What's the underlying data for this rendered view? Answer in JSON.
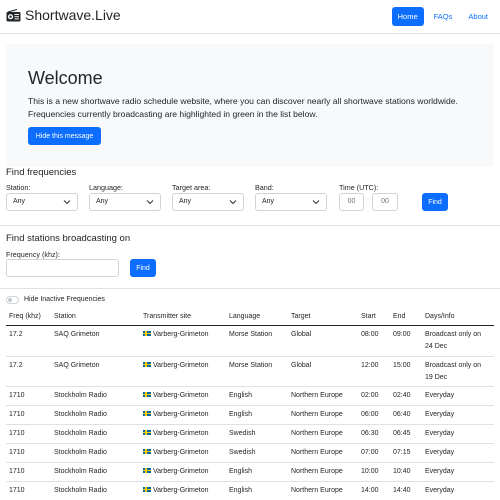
{
  "nav": {
    "brand": "Shortwave.Live",
    "links": [
      {
        "label": "Home",
        "active": true
      },
      {
        "label": "FAQs",
        "active": false
      },
      {
        "label": "About",
        "active": false
      }
    ]
  },
  "welcome": {
    "title": "Welcome",
    "text": "This is a new shortwave radio schedule website, where you can discover nearly all shortwave stations worldwide. Frequencies currently broadcasting are highlighted in green in the list below.",
    "button": "Hide this message"
  },
  "find_frequencies": {
    "title": "Find frequencies",
    "station_label": "Station:",
    "station_value": "Any",
    "language_label": "Language:",
    "language_value": "Any",
    "target_label": "Target area:",
    "target_value": "Any",
    "band_label": "Band:",
    "band_value": "Any",
    "time_label": "Time (UTC):",
    "time_hour_placeholder": "00",
    "time_minute_placeholder": "00",
    "find_button": "Find"
  },
  "find_stations": {
    "title": "Find stations broadcasting on",
    "freq_label": "Frequency (khz):",
    "find_button": "Find"
  },
  "toggle": {
    "label": "Hide Inactive Frequencies",
    "on": false
  },
  "table": {
    "headers": [
      "Freq (khz)",
      "Station",
      "Transmitter site",
      "Language",
      "Target",
      "Start",
      "End",
      "Days/Info"
    ],
    "rows": [
      {
        "freq": "17.2",
        "station": "SAQ Grimeton",
        "site": "Varberg-Grimeton",
        "language": "Morse Station",
        "target": "Global",
        "start": "08:00",
        "end": "09:00",
        "days1": "Broadcast only on",
        "days2": "24 Dec"
      },
      {
        "freq": "17.2",
        "station": "SAQ Grimeton",
        "site": "Varberg-Grimeton",
        "language": "Morse Station",
        "target": "Global",
        "start": "12:00",
        "end": "15:00",
        "days1": "Broadcast only on",
        "days2": "19 Dec"
      },
      {
        "freq": "1710",
        "station": "Stockholm Radio",
        "site": "Varberg-Grimeton",
        "language": "English",
        "target": "Northern Europe",
        "start": "02:00",
        "end": "02:40",
        "days1": "Everyday",
        "days2": ""
      },
      {
        "freq": "1710",
        "station": "Stockholm Radio",
        "site": "Varberg-Grimeton",
        "language": "English",
        "target": "Northern Europe",
        "start": "06:00",
        "end": "06:40",
        "days1": "Everyday",
        "days2": ""
      },
      {
        "freq": "1710",
        "station": "Stockholm Radio",
        "site": "Varberg-Grimeton",
        "language": "Swedish",
        "target": "Northern Europe",
        "start": "06:30",
        "end": "06:45",
        "days1": "Everyday",
        "days2": ""
      },
      {
        "freq": "1710",
        "station": "Stockholm Radio",
        "site": "Varberg-Grimeton",
        "language": "Swedish",
        "target": "Northern Europe",
        "start": "07:00",
        "end": "07:15",
        "days1": "Everyday",
        "days2": ""
      },
      {
        "freq": "1710",
        "station": "Stockholm Radio",
        "site": "Varberg-Grimeton",
        "language": "English",
        "target": "Northern Europe",
        "start": "10:00",
        "end": "10:40",
        "days1": "Everyday",
        "days2": ""
      },
      {
        "freq": "1710",
        "station": "Stockholm Radio",
        "site": "Varberg-Grimeton",
        "language": "English",
        "target": "Northern Europe",
        "start": "14:00",
        "end": "14:40",
        "days1": "Everyday",
        "days2": ""
      }
    ]
  },
  "icons": {
    "brand": "radio-icon",
    "select": "chevron-down-icon",
    "flag": "sweden-flag-icon"
  }
}
